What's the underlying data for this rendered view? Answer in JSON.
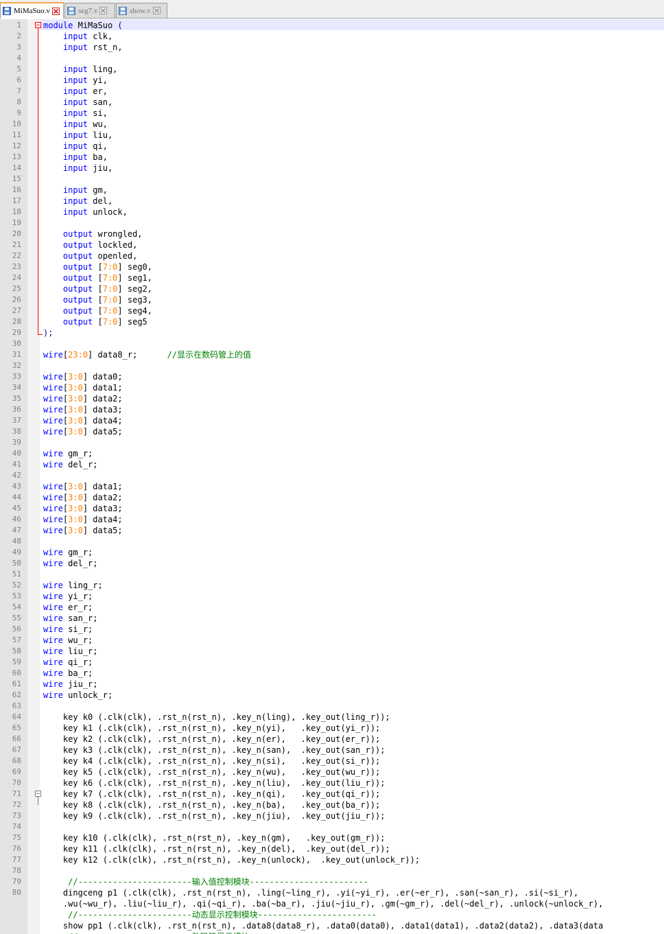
{
  "tabs": [
    {
      "label": "MiMaSuo.v",
      "active": true
    },
    {
      "label": "seg7.v",
      "active": false
    },
    {
      "label": "show.v",
      "active": false
    }
  ],
  "colors": {
    "keyword": "#0000ff",
    "number": "#ff8000",
    "comment": "#008000",
    "text": "#000000",
    "tab_active_accent": "#f2a74c",
    "fold_marker": "#ff0000"
  },
  "icons": {
    "tab_file": "floppy-disk-icon",
    "tab_close": "close-x-icon",
    "fold": "fold-minus-icon"
  },
  "lines": [
    {
      "n": "1",
      "segs": [
        [
          "kw",
          "module"
        ],
        [
          "",
          "MiMaSuo "
        ],
        [
          "op",
          "("
        ]
      ]
    },
    {
      "n": "2",
      "segs": [
        [
          "",
          "    "
        ],
        [
          "kw",
          "input"
        ],
        [
          "",
          "clk,"
        ]
      ]
    },
    {
      "n": "3",
      "segs": [
        [
          "",
          "    "
        ],
        [
          "kw",
          "input"
        ],
        [
          "",
          "rst_n,"
        ]
      ]
    },
    {
      "n": "4",
      "segs": []
    },
    {
      "n": "5",
      "segs": [
        [
          "",
          "    "
        ],
        [
          "kw",
          "input"
        ],
        [
          "",
          "ling,"
        ]
      ]
    },
    {
      "n": "6",
      "segs": [
        [
          "",
          "    "
        ],
        [
          "kw",
          "input"
        ],
        [
          "",
          "yi,"
        ]
      ]
    },
    {
      "n": "7",
      "segs": [
        [
          "",
          "    "
        ],
        [
          "kw",
          "input"
        ],
        [
          "",
          "er,"
        ]
      ]
    },
    {
      "n": "8",
      "segs": [
        [
          "",
          "    "
        ],
        [
          "kw",
          "input"
        ],
        [
          "",
          "san,"
        ]
      ]
    },
    {
      "n": "9",
      "segs": [
        [
          "",
          "    "
        ],
        [
          "kw",
          "input"
        ],
        [
          "",
          "si,"
        ]
      ]
    },
    {
      "n": "10",
      "segs": [
        [
          "",
          "    "
        ],
        [
          "kw",
          "input"
        ],
        [
          "",
          "wu,"
        ]
      ]
    },
    {
      "n": "11",
      "segs": [
        [
          "",
          "    "
        ],
        [
          "kw",
          "input"
        ],
        [
          "",
          "liu,"
        ]
      ]
    },
    {
      "n": "12",
      "segs": [
        [
          "",
          "    "
        ],
        [
          "kw",
          "input"
        ],
        [
          "",
          "qi,"
        ]
      ]
    },
    {
      "n": "13",
      "segs": [
        [
          "",
          "    "
        ],
        [
          "kw",
          "input"
        ],
        [
          "",
          "ba,"
        ]
      ]
    },
    {
      "n": "14",
      "segs": [
        [
          "",
          "    "
        ],
        [
          "kw",
          "input"
        ],
        [
          "",
          "jiu,"
        ]
      ]
    },
    {
      "n": "15",
      "segs": []
    },
    {
      "n": "16",
      "segs": [
        [
          "",
          "    "
        ],
        [
          "kw",
          "input"
        ],
        [
          "",
          "gm,"
        ]
      ]
    },
    {
      "n": "17",
      "segs": [
        [
          "",
          "    "
        ],
        [
          "kw",
          "input"
        ],
        [
          "",
          "del,"
        ]
      ]
    },
    {
      "n": "18",
      "segs": [
        [
          "",
          "    "
        ],
        [
          "kw",
          "input"
        ],
        [
          "",
          "unlock,"
        ]
      ]
    },
    {
      "n": "19",
      "segs": []
    },
    {
      "n": "20",
      "segs": [
        [
          "",
          "    "
        ],
        [
          "kw",
          "output"
        ],
        [
          "",
          "wrongled,"
        ]
      ]
    },
    {
      "n": "21",
      "segs": [
        [
          "",
          "    "
        ],
        [
          "kw",
          "output"
        ],
        [
          "",
          "lockled,"
        ]
      ]
    },
    {
      "n": "22",
      "segs": [
        [
          "",
          "    "
        ],
        [
          "kw",
          "output"
        ],
        [
          "",
          "openled,"
        ]
      ]
    },
    {
      "n": "23",
      "segs": [
        [
          "",
          "    "
        ],
        [
          "kw",
          "output"
        ],
        [
          "",
          "["
        ],
        [
          "num",
          "7:0"
        ],
        [
          "",
          "] seg0,"
        ]
      ]
    },
    {
      "n": "24",
      "segs": [
        [
          "",
          "    "
        ],
        [
          "kw",
          "output"
        ],
        [
          "",
          "["
        ],
        [
          "num",
          "7:0"
        ],
        [
          "",
          "] seg1,"
        ]
      ]
    },
    {
      "n": "25",
      "segs": [
        [
          "",
          "    "
        ],
        [
          "kw",
          "output"
        ],
        [
          "",
          "["
        ],
        [
          "num",
          "7:0"
        ],
        [
          "",
          "] seg2,"
        ]
      ]
    },
    {
      "n": "26",
      "segs": [
        [
          "",
          "    "
        ],
        [
          "kw",
          "output"
        ],
        [
          "",
          "["
        ],
        [
          "num",
          "7:0"
        ],
        [
          "",
          "] seg3,"
        ]
      ]
    },
    {
      "n": "27",
      "segs": [
        [
          "",
          "    "
        ],
        [
          "kw",
          "output"
        ],
        [
          "",
          "["
        ],
        [
          "num",
          "7:0"
        ],
        [
          "",
          "] seg4,"
        ]
      ]
    },
    {
      "n": "28",
      "segs": [
        [
          "",
          "    "
        ],
        [
          "kw",
          "output"
        ],
        [
          "",
          "["
        ],
        [
          "num",
          "7:0"
        ],
        [
          "",
          "] seg5"
        ]
      ]
    },
    {
      "n": "29",
      "segs": [
        [
          "op",
          ");"
        ]
      ]
    },
    {
      "n": "30",
      "segs": []
    },
    {
      "n": "31",
      "segs": [
        [
          "kw",
          "wire"
        ],
        [
          "",
          "["
        ],
        [
          "num",
          "23:0"
        ],
        [
          "",
          "] data8_r;      "
        ],
        [
          "cm",
          "//显示在数码管上的值"
        ]
      ]
    },
    {
      "n": "32",
      "segs": []
    },
    {
      "n": "33",
      "segs": [
        [
          "kw",
          "wire"
        ],
        [
          "",
          "["
        ],
        [
          "num",
          "3:0"
        ],
        [
          "",
          "] data0;"
        ]
      ]
    },
    {
      "n": "34",
      "segs": [
        [
          "kw",
          "wire"
        ],
        [
          "",
          "["
        ],
        [
          "num",
          "3:0"
        ],
        [
          "",
          "] data1;"
        ]
      ]
    },
    {
      "n": "35",
      "segs": [
        [
          "kw",
          "wire"
        ],
        [
          "",
          "["
        ],
        [
          "num",
          "3:0"
        ],
        [
          "",
          "] data2;"
        ]
      ]
    },
    {
      "n": "36",
      "segs": [
        [
          "kw",
          "wire"
        ],
        [
          "",
          "["
        ],
        [
          "num",
          "3:0"
        ],
        [
          "",
          "] data3;"
        ]
      ]
    },
    {
      "n": "37",
      "segs": [
        [
          "kw",
          "wire"
        ],
        [
          "",
          "["
        ],
        [
          "num",
          "3:0"
        ],
        [
          "",
          "] data4;"
        ]
      ]
    },
    {
      "n": "38",
      "segs": [
        [
          "kw",
          "wire"
        ],
        [
          "",
          "["
        ],
        [
          "num",
          "3:0"
        ],
        [
          "",
          "] data5;"
        ]
      ]
    },
    {
      "n": "39",
      "segs": []
    },
    {
      "n": "40",
      "segs": [
        [
          "kw",
          "wire"
        ],
        [
          "",
          "gm_r;"
        ]
      ]
    },
    {
      "n": "41",
      "segs": [
        [
          "kw",
          "wire"
        ],
        [
          "",
          "del_r;"
        ]
      ]
    },
    {
      "n": "42",
      "segs": []
    },
    {
      "n": "43",
      "segs": [
        [
          "kw",
          "wire"
        ],
        [
          "",
          "["
        ],
        [
          "num",
          "3:0"
        ],
        [
          "",
          "] data1;"
        ]
      ]
    },
    {
      "n": "44",
      "segs": [
        [
          "kw",
          "wire"
        ],
        [
          "",
          "["
        ],
        [
          "num",
          "3:0"
        ],
        [
          "",
          "] data2;"
        ]
      ]
    },
    {
      "n": "45",
      "segs": [
        [
          "kw",
          "wire"
        ],
        [
          "",
          "["
        ],
        [
          "num",
          "3:0"
        ],
        [
          "",
          "] data3;"
        ]
      ]
    },
    {
      "n": "46",
      "segs": [
        [
          "kw",
          "wire"
        ],
        [
          "",
          "["
        ],
        [
          "num",
          "3:0"
        ],
        [
          "",
          "] data4;"
        ]
      ]
    },
    {
      "n": "47",
      "segs": [
        [
          "kw",
          "wire"
        ],
        [
          "",
          "["
        ],
        [
          "num",
          "3:0"
        ],
        [
          "",
          "] data5;"
        ]
      ]
    },
    {
      "n": "48",
      "segs": []
    },
    {
      "n": "49",
      "segs": [
        [
          "kw",
          "wire"
        ],
        [
          "",
          "gm_r;"
        ]
      ]
    },
    {
      "n": "50",
      "segs": [
        [
          "kw",
          "wire"
        ],
        [
          "",
          "del_r;"
        ]
      ]
    },
    {
      "n": "51",
      "segs": []
    },
    {
      "n": "52",
      "segs": [
        [
          "kw",
          "wire"
        ],
        [
          "",
          "ling_r;"
        ]
      ]
    },
    {
      "n": "53",
      "segs": [
        [
          "kw",
          "wire"
        ],
        [
          "",
          "yi_r;"
        ]
      ]
    },
    {
      "n": "54",
      "segs": [
        [
          "kw",
          "wire"
        ],
        [
          "",
          "er_r;"
        ]
      ]
    },
    {
      "n": "55",
      "segs": [
        [
          "kw",
          "wire"
        ],
        [
          "",
          "san_r;"
        ]
      ]
    },
    {
      "n": "56",
      "segs": [
        [
          "kw",
          "wire"
        ],
        [
          "",
          "si_r;"
        ]
      ]
    },
    {
      "n": "57",
      "segs": [
        [
          "kw",
          "wire"
        ],
        [
          "",
          "wu_r;"
        ]
      ]
    },
    {
      "n": "58",
      "segs": [
        [
          "kw",
          "wire"
        ],
        [
          "",
          "liu_r;"
        ]
      ]
    },
    {
      "n": "59",
      "segs": [
        [
          "kw",
          "wire"
        ],
        [
          "",
          "qi_r;"
        ]
      ]
    },
    {
      "n": "60",
      "segs": [
        [
          "kw",
          "wire"
        ],
        [
          "",
          "ba_r;"
        ]
      ]
    },
    {
      "n": "61",
      "segs": [
        [
          "kw",
          "wire"
        ],
        [
          "",
          "jiu_r;"
        ]
      ]
    },
    {
      "n": "62",
      "segs": [
        [
          "kw",
          "wire"
        ],
        [
          "",
          "unlock_r;"
        ]
      ]
    },
    {
      "n": "63",
      "segs": []
    },
    {
      "n": "64",
      "segs": [
        [
          "",
          "    key k0 (.clk(clk), .rst_n(rst_n), .key_n(ling), .key_out(ling_r));"
        ]
      ]
    },
    {
      "n": "65",
      "segs": [
        [
          "",
          "    key k1 (.clk(clk), .rst_n(rst_n), .key_n(yi),   .key_out(yi_r));"
        ]
      ]
    },
    {
      "n": "66",
      "segs": [
        [
          "",
          "    key k2 (.clk(clk), .rst_n(rst_n), .key_n(er),   .key_out(er_r));"
        ]
      ]
    },
    {
      "n": "67",
      "segs": [
        [
          "",
          "    key k3 (.clk(clk), .rst_n(rst_n), .key_n(san),  .key_out(san_r));"
        ]
      ]
    },
    {
      "n": "68",
      "segs": [
        [
          "",
          "    key k4 (.clk(clk), .rst_n(rst_n), .key_n(si),   .key_out(si_r));"
        ]
      ]
    },
    {
      "n": "69",
      "segs": [
        [
          "",
          "    key k5 (.clk(clk), .rst_n(rst_n), .key_n(wu),   .key_out(wu_r));"
        ]
      ]
    },
    {
      "n": "70",
      "segs": [
        [
          "",
          "    key k6 (.clk(clk), .rst_n(rst_n), .key_n(liu),  .key_out(liu_r));"
        ]
      ]
    },
    {
      "n": "71",
      "segs": [
        [
          "",
          "    key k7 (.clk(clk), .rst_n(rst_n), .key_n(qi),   .key_out(qi_r));"
        ]
      ]
    },
    {
      "n": "72",
      "segs": [
        [
          "",
          "    key k8 (.clk(clk), .rst_n(rst_n), .key_n(ba),   .key_out(ba_r));"
        ]
      ]
    },
    {
      "n": "73",
      "segs": [
        [
          "",
          "    key k9 (.clk(clk), .rst_n(rst_n), .key_n(jiu),  .key_out(jiu_r));"
        ]
      ]
    },
    {
      "n": "74",
      "segs": []
    },
    {
      "n": "75",
      "segs": [
        [
          "",
          "    key k10 (.clk(clk), .rst_n(rst_n), .key_n(gm),   .key_out(gm_r));"
        ]
      ]
    },
    {
      "n": "76",
      "segs": [
        [
          "",
          "    key k11 (.clk(clk), .rst_n(rst_n), .key_n(del),  .key_out(del_r));"
        ]
      ]
    },
    {
      "n": "77",
      "segs": [
        [
          "",
          "    key k12 (.clk(clk), .rst_n(rst_n), .key_n(unlock),  .key_out(unlock_r));"
        ]
      ]
    },
    {
      "n": "78",
      "segs": []
    },
    {
      "n": "79",
      "segs": [
        [
          "",
          "     "
        ],
        [
          "cm",
          "//-----------------------输入值控制模块------------------------"
        ]
      ]
    },
    {
      "n": "80",
      "segs": [
        [
          "",
          "    dingceng p1 (.clk(clk), .rst_n(rst_n), .ling(~ling_r), .yi(~yi_r), .er(~er_r), .san(~san_r), .si(~si_r),"
        ]
      ]
    },
    {
      "n": "",
      "segs": [
        [
          "",
          "    .wu(~wu_r), .liu(~liu_r), .qi(~qi_r), .ba(~ba_r), .jiu(~jiu_r), .gm(~gm_r), .del(~del_r), .unlock(~unlock_r),"
        ]
      ]
    },
    {
      "n": "",
      "segs": [
        [
          "",
          "     "
        ],
        [
          "cm",
          "//-----------------------动态显示控制模块------------------------"
        ]
      ]
    },
    {
      "n": "",
      "segs": [
        [
          "",
          "    show pp1 (.clk(clk), .rst_n(rst_n), .data8(data8_r), .data0(data0), .data1(data1), .data2(data2), .data3(data"
        ]
      ]
    },
    {
      "n": "",
      "segs": [
        [
          "",
          "     "
        ],
        [
          "cm",
          "//-----------------------数码管显示模块------------------------"
        ]
      ]
    }
  ]
}
